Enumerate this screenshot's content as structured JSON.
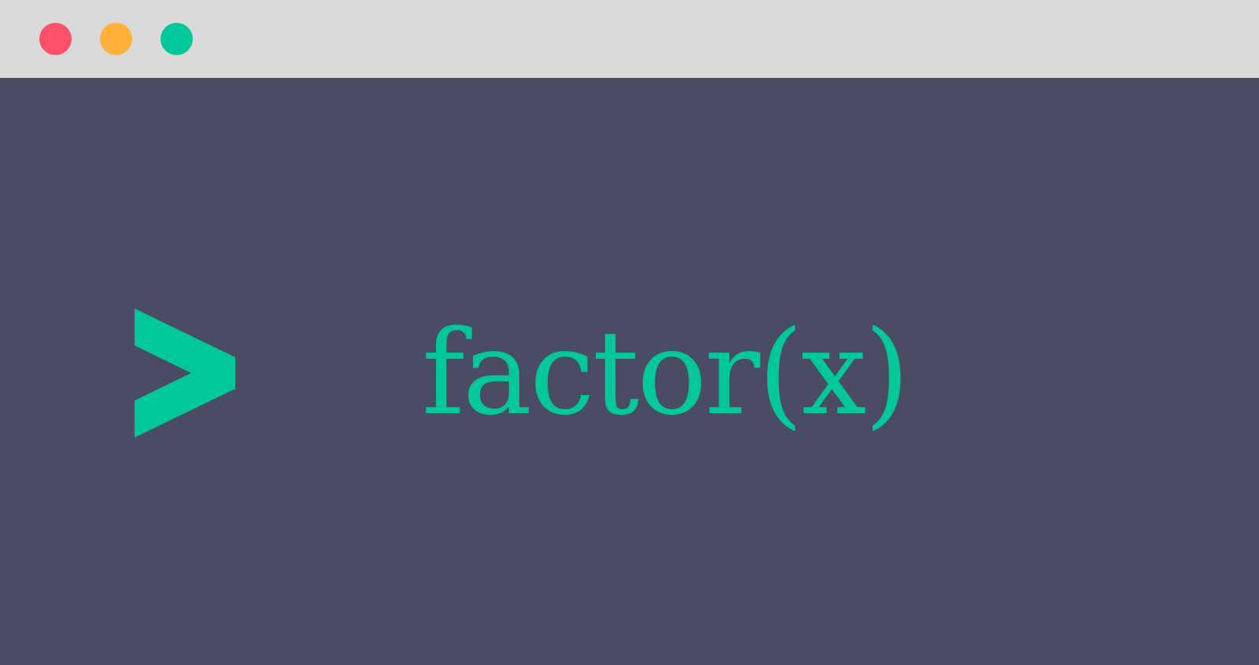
{
  "window": {
    "background_color": "#4a4c63",
    "titlebar_color": "#d9d9d9",
    "controls": [
      {
        "name": "close",
        "color": "#ff4f6a"
      },
      {
        "name": "minimize",
        "color": "#ffb03b"
      },
      {
        "name": "maximize",
        "color": "#00c89b"
      }
    ]
  },
  "terminal": {
    "prompt_icon": "chevron-right-icon",
    "accent_color": "#00c89b",
    "command_text": "factor(x)"
  }
}
